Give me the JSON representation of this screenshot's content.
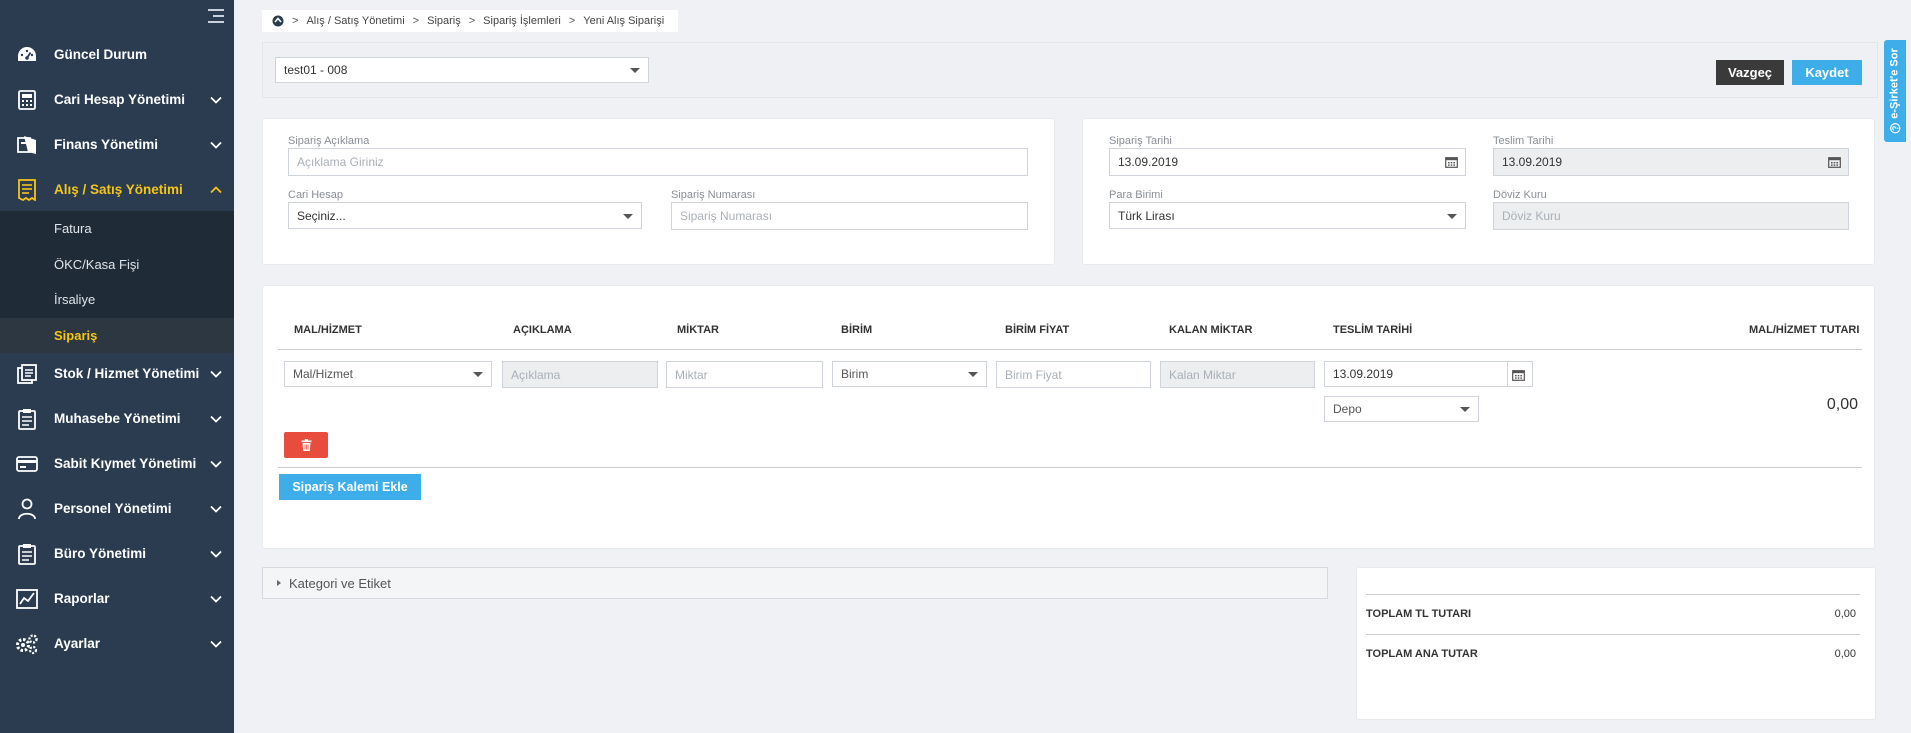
{
  "sidebar": {
    "items": [
      {
        "label": "Güncel Durum",
        "icon": "dashboard-icon"
      },
      {
        "label": "Cari Hesap Yönetimi",
        "icon": "calculator-icon"
      },
      {
        "label": "Finans Yönetimi",
        "icon": "finance-icon"
      },
      {
        "label": "Alış / Satış Yönetimi",
        "icon": "receipt-icon"
      },
      {
        "label": "Stok / Hizmet Yönetimi",
        "icon": "stock-icon"
      },
      {
        "label": "Muhasebe Yönetimi",
        "icon": "clipboard-icon"
      },
      {
        "label": "Sabit Kıymet Yönetimi",
        "icon": "card-icon"
      },
      {
        "label": "Personel Yönetimi",
        "icon": "person-icon"
      },
      {
        "label": "Büro Yönetimi",
        "icon": "clipboard-icon"
      },
      {
        "label": "Raporlar",
        "icon": "chart-icon"
      },
      {
        "label": "Ayarlar",
        "icon": "gears-icon"
      }
    ],
    "sub_items": [
      "Fatura",
      "ÖKC/Kasa Fişi",
      "İrsaliye",
      "Sipariş"
    ],
    "active_color": "#f5c518"
  },
  "breadcrumb": [
    "Alış / Satış Yönetimi",
    "Sipariş",
    "Sipariş İşlemleri",
    "Yeni Alış Siparişi"
  ],
  "topbar": {
    "company_select": "test01 - 008",
    "cancel_label": "Vazgeç",
    "save_label": "Kaydet"
  },
  "form_left": {
    "desc_label": "Sipariş Açıklama",
    "desc_placeholder": "Açıklama Giriniz",
    "account_label": "Cari Hesap",
    "account_value": "Seçiniz...",
    "order_no_label": "Sipariş Numarası",
    "order_no_placeholder": "Sipariş Numarası"
  },
  "form_right": {
    "order_date_label": "Sipariş Tarihi",
    "order_date": "13.09.2019",
    "delivery_date_label": "Teslim Tarihi",
    "delivery_date": "13.09.2019",
    "currency_label": "Para Birimi",
    "currency_value": "Türk Lirası",
    "rate_label": "Döviz Kuru",
    "rate_placeholder": "Döviz Kuru"
  },
  "items_table": {
    "headers": [
      "MAL/HİZMET",
      "AÇIKLAMA",
      "MİKTAR",
      "BİRİM",
      "BİRİM FİYAT",
      "KALAN MİKTAR",
      "TESLİM TARİHİ",
      "MAL/HİZMET TUTARI"
    ],
    "row": {
      "product_value": "Mal/Hizmet",
      "desc_placeholder": "Açıklama",
      "qty_placeholder": "Miktar",
      "unit_value": "Birim",
      "price_placeholder": "Birim Fiyat",
      "remaining_placeholder": "Kalan Miktar",
      "delivery_date": "13.09.2019",
      "warehouse_value": "Depo",
      "total": "0,00"
    },
    "add_label": "Sipariş Kalemi Ekle"
  },
  "category_label": "Kategori ve Etiket",
  "totals": {
    "tl_label": "TOPLAM TL TUTARI",
    "tl_value": "0,00",
    "main_label": "TOPLAM ANA TUTAR",
    "main_value": "0,00"
  },
  "side_tab_label": "e-Şirket'e Sor",
  "colors": {
    "sidebar_bg": "#2b3c50",
    "primary": "#3daeea",
    "danger": "#e74c3c",
    "dark_button": "#3a3a3a"
  }
}
